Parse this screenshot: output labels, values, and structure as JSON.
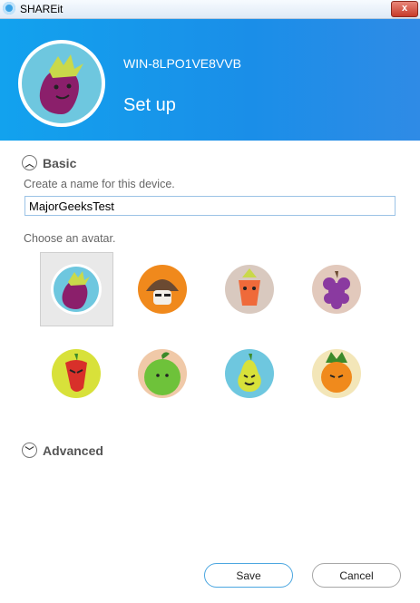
{
  "window": {
    "title": "SHAREit",
    "close_label": "x"
  },
  "header": {
    "device_name": "WIN-8LPO1VE8VVB",
    "title": "Set up",
    "avatar": "eggplant-avatar"
  },
  "basic": {
    "section_label": "Basic",
    "name_prompt": "Create a name for this device.",
    "name_value": "MajorGeeksTest",
    "avatar_prompt": "Choose an avatar.",
    "selected_avatar": "eggplant",
    "avatars": [
      "eggplant",
      "mushroom",
      "carrot",
      "grape",
      "pepper",
      "apple",
      "pear",
      "pineapple"
    ]
  },
  "advanced": {
    "section_label": "Advanced"
  },
  "buttons": {
    "save": "Save",
    "cancel": "Cancel"
  },
  "colors": {
    "header_blue": "#1a98ec",
    "save_border": "#4ba6e0"
  }
}
